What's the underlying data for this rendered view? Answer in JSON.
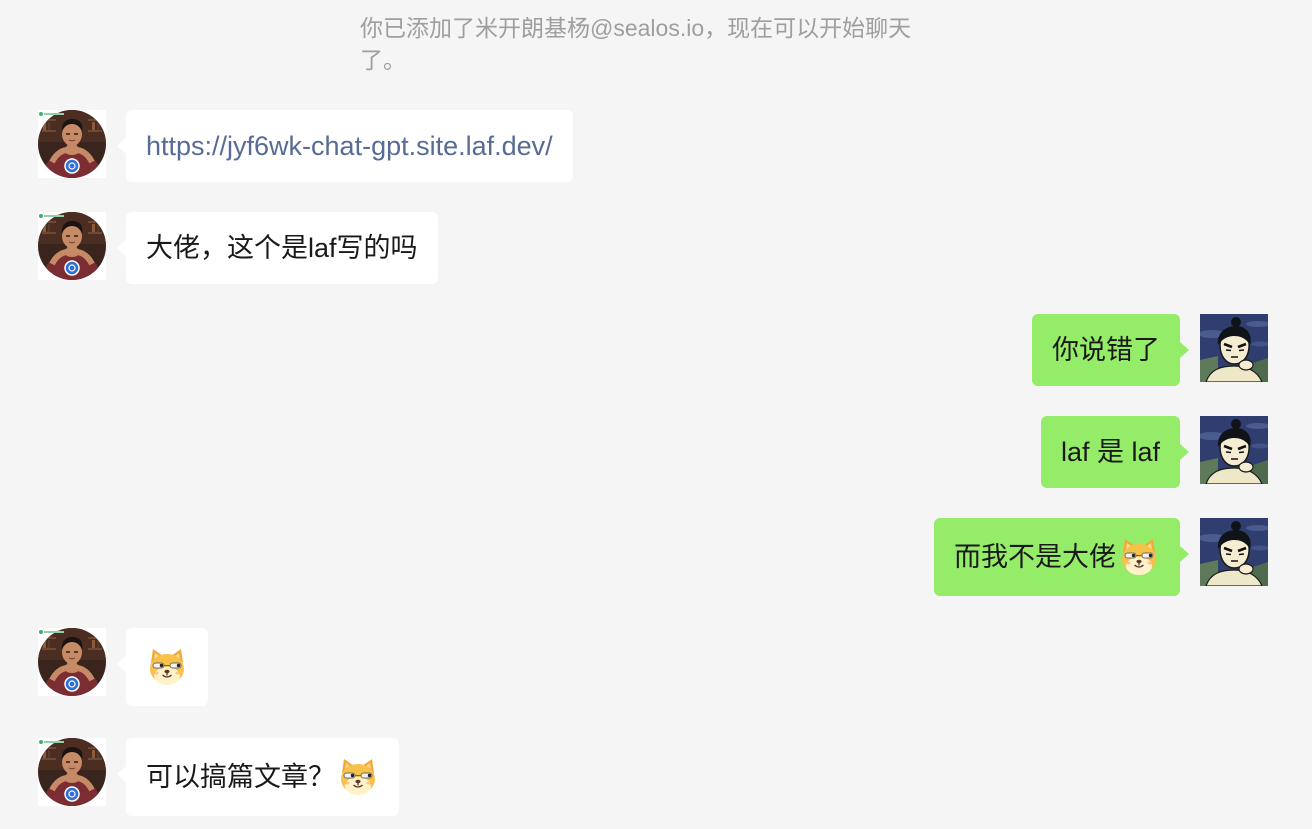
{
  "system_notice": "你已添加了米开朗基杨@sealos.io，现在可以开始聊天了。",
  "contact": {
    "avatar_icon": "contact-photo-avatar"
  },
  "self": {
    "avatar_icon": "cartoon-avatar"
  },
  "messages": [
    {
      "outgoing": false,
      "is_link": true,
      "text": "https://jyf6wk-chat-gpt.site.laf.dev/"
    },
    {
      "outgoing": false,
      "is_link": false,
      "text": "大佬，这个是laf写的吗"
    },
    {
      "outgoing": true,
      "is_link": false,
      "text": "你说错了"
    },
    {
      "outgoing": true,
      "is_link": false,
      "text": "laf 是 laf"
    },
    {
      "outgoing": true,
      "is_link": false,
      "text": "而我不是大佬",
      "emoji": "doge-emoji"
    },
    {
      "outgoing": false,
      "is_link": false,
      "emoji": "doge-emoji"
    },
    {
      "outgoing": false,
      "is_link": false,
      "text": "可以搞篇文章？",
      "emoji": "doge-emoji"
    }
  ],
  "colors": {
    "background": "#f5f5f5",
    "incoming_bubble": "#ffffff",
    "outgoing_bubble": "#95ec69",
    "link": "#576b95",
    "notice_text": "#9e9e9e",
    "message_text": "#191919"
  }
}
